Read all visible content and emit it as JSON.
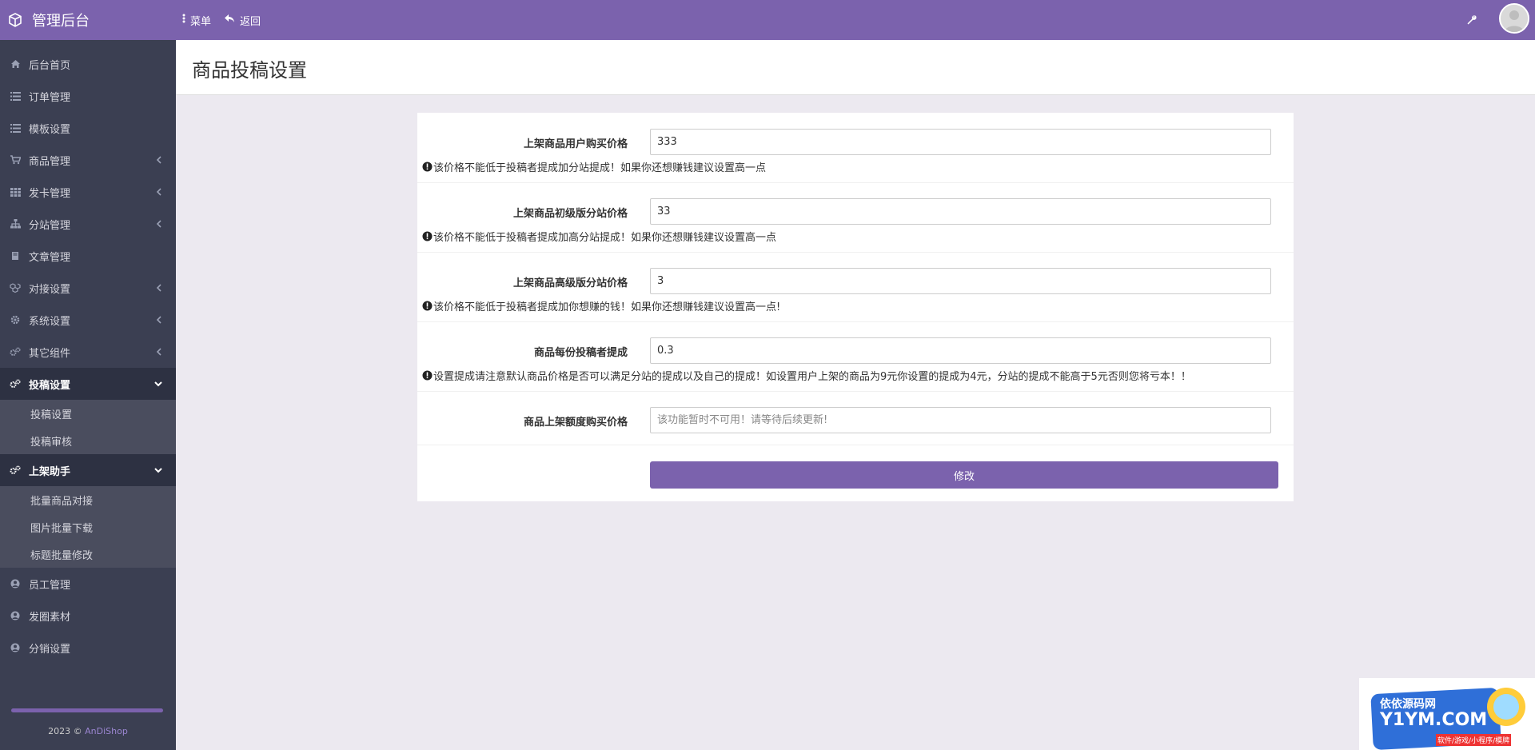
{
  "header": {
    "title": "管理后台",
    "menu_label": "菜单",
    "back_label": "返回"
  },
  "sidebar": {
    "items": [
      {
        "label": "后台首页"
      },
      {
        "label": "订单管理"
      },
      {
        "label": "模板设置"
      },
      {
        "label": "商品管理"
      },
      {
        "label": "发卡管理"
      },
      {
        "label": "分站管理"
      },
      {
        "label": "文章管理"
      },
      {
        "label": "对接设置"
      },
      {
        "label": "系统设置"
      },
      {
        "label": "其它组件"
      },
      {
        "label": "投稿设置"
      },
      {
        "label": "上架助手"
      },
      {
        "label": "员工管理"
      },
      {
        "label": "发圈素材"
      },
      {
        "label": "分销设置"
      }
    ],
    "submenu_tougao": [
      "投稿设置",
      "投稿审核"
    ],
    "submenu_shangjia": [
      "批量商品对接",
      "图片批量下载",
      "标题批量修改"
    ],
    "footer_year": "2023 ©",
    "footer_brand": "AnDiShop"
  },
  "page": {
    "title": "商品投稿设置"
  },
  "form": {
    "fields": [
      {
        "label": "上架商品用户购买价格",
        "value": "333",
        "hint": "该价格不能低于投稿者提成加分站提成！如果你还想赚钱建议设置高一点"
      },
      {
        "label": "上架商品初级版分站价格",
        "value": "33",
        "hint": "该价格不能低于投稿者提成加高分站提成！如果你还想赚钱建议设置高一点"
      },
      {
        "label": "上架商品高级版分站价格",
        "value": "3",
        "hint": "该价格不能低于投稿者提成加你想赚的钱！如果你还想赚钱建议设置高一点!"
      },
      {
        "label": "商品每份投稿者提成",
        "value": "0.3",
        "hint": "设置提成请注意默认商品价格是否可以满足分站的提成以及自己的提成！如设置用户上架的商品为9元你设置的提成为4元，分站的提成不能高于5元否则您将亏本！！"
      },
      {
        "label": "商品上架额度购买价格",
        "value": "",
        "placeholder": "该功能暂时不可用！请等待后续更新!"
      }
    ],
    "submit_label": "修改"
  },
  "watermark": {
    "line1": "依依源码网",
    "line2": "Y1YM.COM",
    "line3": "软件/游戏/小程序/模牌"
  },
  "colors": {
    "accent": "#7b62ad",
    "sidebar_bg": "#3b3f52",
    "sidebar_active": "#2d3142",
    "content_bg": "#ece9f0"
  }
}
